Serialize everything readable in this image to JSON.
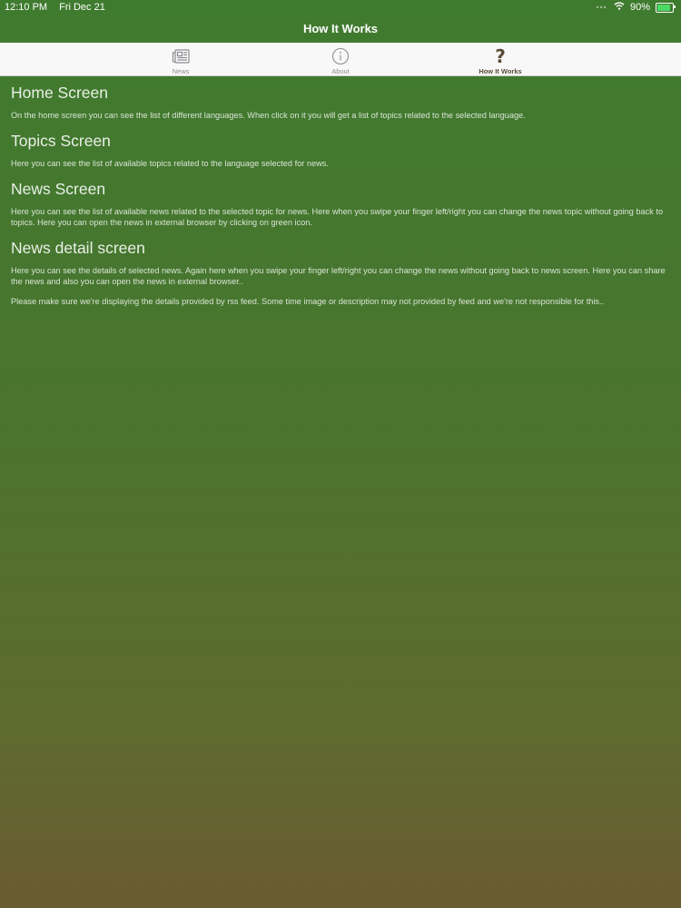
{
  "status": {
    "time": "12:10 PM",
    "date": "Fri Dec 21",
    "battery": "90%",
    "battery_level": 0.9,
    "battery_color": "#4cd964"
  },
  "nav": {
    "title": "How It Works"
  },
  "tabs": [
    {
      "label": "News",
      "icon": "newspaper-icon",
      "active": false
    },
    {
      "label": "About",
      "icon": "info-icon",
      "active": false
    },
    {
      "label": "How It Works",
      "icon": "question-icon",
      "active": true
    }
  ],
  "sections": [
    {
      "heading": "Home Screen",
      "body": "On the home screen you can see the list of different languages. When click on it you will get a list of topics related to the selected language."
    },
    {
      "heading": "Topics Screen",
      "body": "Here you can see the list of available topics related to the language selected for news."
    },
    {
      "heading": "News Screen",
      "body": "Here you can see the list of available news related to the selected topic for news. Here when you swipe your finger left/right you can change the news topic without going back to topics. Here you can open the news in external browser by clicking on green icon."
    },
    {
      "heading": "News detail screen",
      "body": "Here you can see the details of selected news. Again here when you swipe your finger left/right you can change the news without going back to news screen. Here you can share the news and also you can open the news in external browser.."
    }
  ],
  "note": "Please make sure we're displaying the details provided by rss feed. Some time image or description may not provided by feed and we're not responsible for this..",
  "colors": {
    "accent_active": "#5a4b36",
    "inactive": "#8e8e93",
    "background_top": "#3f7b2f",
    "background_bottom": "#6a5b31"
  }
}
